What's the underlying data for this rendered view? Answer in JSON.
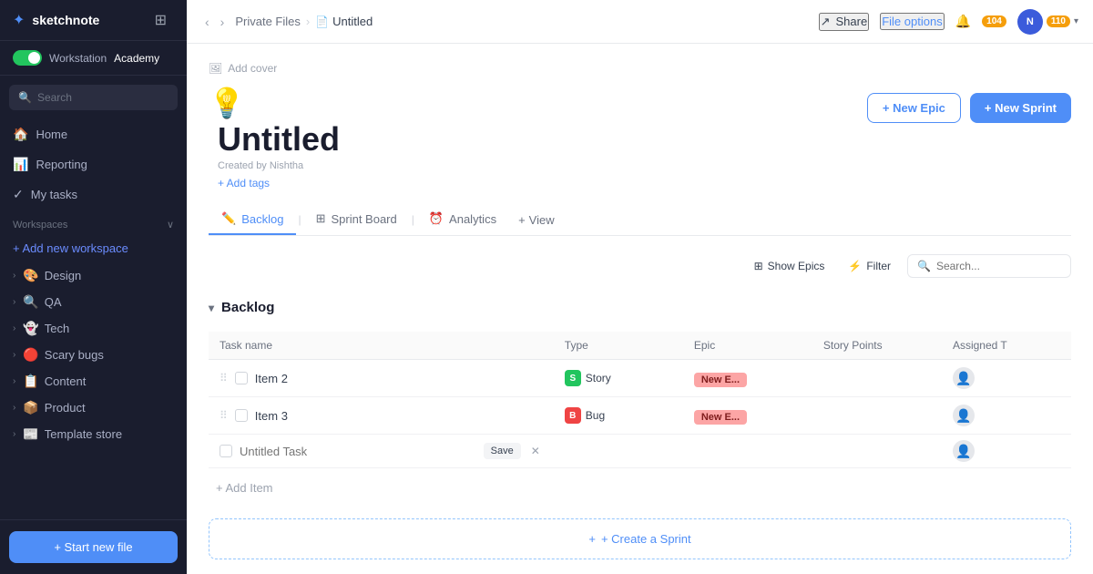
{
  "app": {
    "name": "sketchnote",
    "logo_icon": "✦"
  },
  "sidebar": {
    "workspace_toggle_label": "Workstation",
    "workspace_name": "Academy",
    "search_placeholder": "Search",
    "nav": [
      {
        "id": "home",
        "icon": "🏠",
        "label": "Home"
      },
      {
        "id": "reporting",
        "icon": "📊",
        "label": "Reporting"
      },
      {
        "id": "my-tasks",
        "icon": "✓",
        "label": "My tasks"
      }
    ],
    "workspaces_label": "Workspaces",
    "add_workspace_label": "+ Add new workspace",
    "workspace_items": [
      {
        "id": "design",
        "emoji": "🎨",
        "label": "Design"
      },
      {
        "id": "qa",
        "emoji": "🔍",
        "label": "QA"
      },
      {
        "id": "tech",
        "emoji": "👻",
        "label": "Tech"
      },
      {
        "id": "scary-bugs",
        "emoji": "🔴",
        "label": "Scary bugs"
      },
      {
        "id": "content",
        "emoji": "📋",
        "label": "Content"
      },
      {
        "id": "product",
        "emoji": "📦",
        "label": "Product"
      },
      {
        "id": "template-store",
        "emoji": "📰",
        "label": "Template store"
      }
    ],
    "start_file_btn": "+ Start new file"
  },
  "topbar": {
    "breadcrumb_parent": "Private Files",
    "breadcrumb_current": "Untitled",
    "share_label": "Share",
    "file_options_label": "File options",
    "notification_count": "104",
    "avatar_initials": "N",
    "avatar_badge": "110",
    "sidebar_icon": "⊞"
  },
  "page": {
    "add_cover_label": "Add cover",
    "emoji": "💡",
    "title": "Untitled",
    "created_by": "Created by Nishtha",
    "add_tags_label": "+ Add tags",
    "new_epic_btn": "+ New Epic",
    "new_sprint_btn": "+ New Sprint"
  },
  "tabs": [
    {
      "id": "backlog",
      "icon": "✏️",
      "label": "Backlog",
      "active": true
    },
    {
      "id": "sprint-board",
      "icon": "⊞",
      "label": "Sprint Board"
    },
    {
      "id": "analytics",
      "icon": "⏰",
      "label": "Analytics"
    },
    {
      "id": "view",
      "icon": "+",
      "label": "View"
    }
  ],
  "toolbar": {
    "show_epics_label": "Show Epics",
    "filter_label": "Filter",
    "search_placeholder": "Search..."
  },
  "backlog": {
    "section_label": "Backlog",
    "table": {
      "columns": [
        "Task name",
        "Type",
        "Epic",
        "Story Points",
        "Assigned T"
      ],
      "rows": [
        {
          "id": "item2",
          "name": "Item 2",
          "type_label": "Story",
          "type_kind": "story",
          "type_icon": "S",
          "epic_label": "New E...",
          "story_points": "",
          "assigned": ""
        },
        {
          "id": "item3",
          "name": "Item 3",
          "type_label": "Bug",
          "type_kind": "bug",
          "type_icon": "B",
          "epic_label": "New E...",
          "story_points": "",
          "assigned": ""
        }
      ],
      "new_task_placeholder": "Untitled Task",
      "save_label": "Save",
      "cancel_label": "✕"
    },
    "add_item_label": "+ Add Item",
    "create_sprint_label": "+ Create a Sprint"
  }
}
